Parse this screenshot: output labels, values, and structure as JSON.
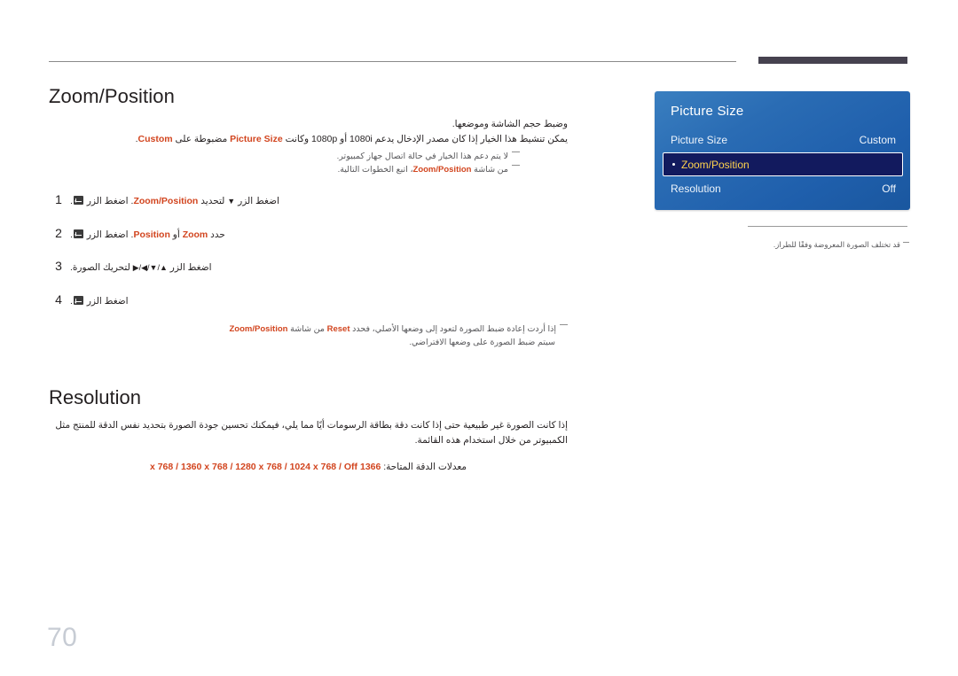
{
  "page": {
    "number": "70"
  },
  "sections": {
    "zoom_position": {
      "title": "Zoom/Position",
      "lead_1": "وضبط حجم الشاشة وموضعها.",
      "lead_2_pre": "يمكن تنشيط هذا الخيار إذا كان مصدر الإدخال يدعم ",
      "lead_2_res": "1080i",
      "lead_2_mid": " أو ",
      "lead_2_res2": "1080p",
      "lead_2_mid2": " وكانت ",
      "lead_2_picture_size": "Picture Size",
      "lead_2_post": " مضبوطة على ",
      "lead_2_custom": "Custom",
      "lead_2_end": ".",
      "note_1": "لا يتم دعم هذا الخيار في حالة اتصال جهاز كمبيوتر.",
      "note_2_pre": "من شاشة ",
      "note_2_link": "Zoom/Position",
      "note_2_post": "، اتبع الخطوات التالية.",
      "steps": [
        {
          "num": "1",
          "pre": "اضغط الزر ",
          "arrow": "▼",
          "mid": " لتحديد ",
          "highlight": "Zoom/Position",
          "post": ". اضغط الزر ",
          "tail": "."
        },
        {
          "num": "2",
          "pre": "حدد ",
          "highlight": "Zoom",
          "mid": " أو ",
          "highlight2": "Position",
          "post": ". اضغط الزر ",
          "tail": "."
        },
        {
          "num": "3",
          "pre": "اضغط الزر ",
          "arrow": "▲/▼/◀/▶",
          "post": " لتحريك الصورة.",
          "tail": ""
        },
        {
          "num": "4",
          "pre": "اضغط الزر ",
          "post": "",
          "tail": "."
        }
      ],
      "reset_note_pre": "إذا أردت إعادة ضبط الصورة لتعود إلى وضعها الأصلي، فحدد ",
      "reset_note_reset": "Reset",
      "reset_note_mid": " من شاشة ",
      "reset_note_link": "Zoom/Position",
      "reset_note_line2": "سيتم ضبط الصورة على وضعها الافتراضي."
    },
    "resolution": {
      "title": "Resolution",
      "body": "إذا كانت الصورة غير طبيعية حتى إذا كانت دقة بطاقة الرسومات أيًا مما يلي، فيمكنك تحسين جودة الصورة بتحديد نفس الدقة للمنتج مثل الكمبيوتر من خلال استخدام هذه القائمة.",
      "list_label": "معدلات الدقة المتاحة: ",
      "list_values": "1366 x 768 / 1360 x 768 / 1280 x 768 / 1024 x 768 / Off"
    }
  },
  "osd": {
    "title": "Picture Size",
    "rows": [
      {
        "label": "Picture Size",
        "value": "Custom",
        "selected": false
      },
      {
        "label": "Zoom/Position",
        "value": "",
        "selected": true
      },
      {
        "label": "Resolution",
        "value": "Off",
        "selected": false
      }
    ],
    "note": "قد تختلف الصورة المعروضة وفقًا للطراز."
  },
  "colors": {
    "accent_orange": "#d2451f",
    "osd_blue_top": "#3a7fc0",
    "osd_blue_bottom": "#1a579f",
    "osd_selected_bg": "#121a5e",
    "osd_selected_text": "#ffd34d",
    "header_bar": "#46424f",
    "page_number": "#c7ccd4"
  }
}
